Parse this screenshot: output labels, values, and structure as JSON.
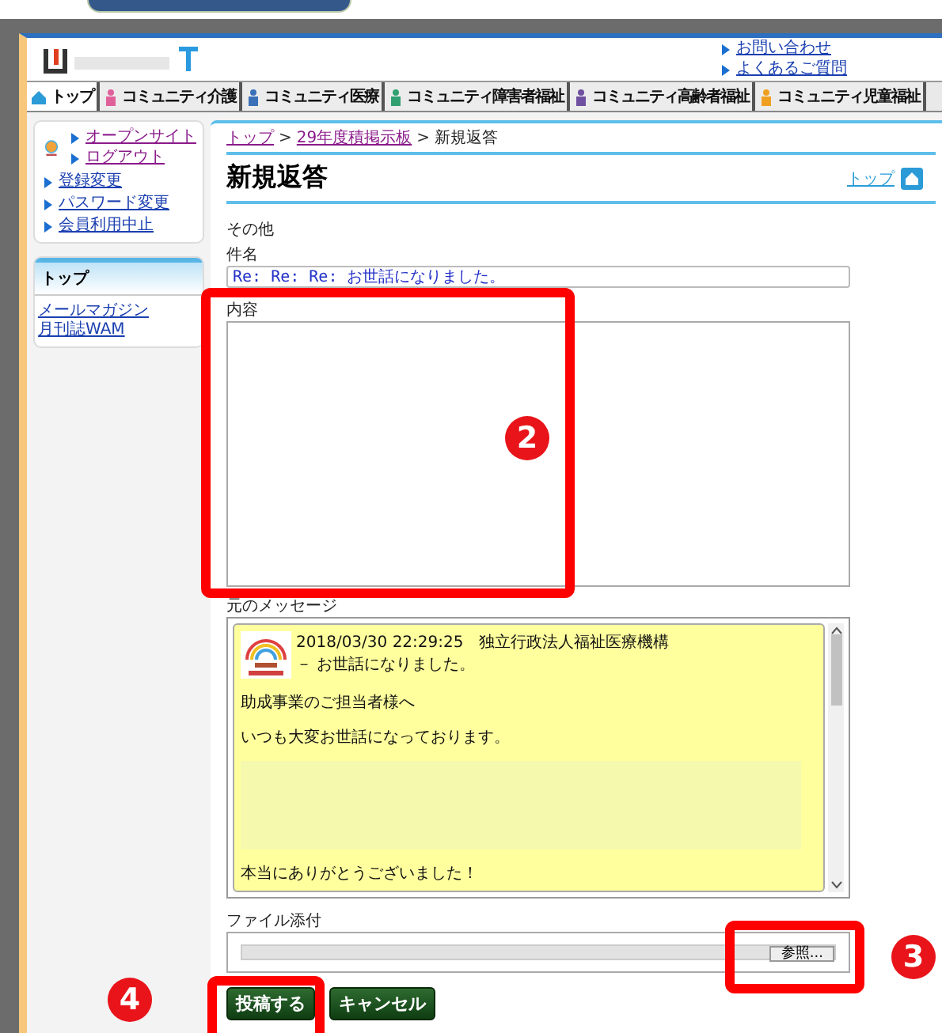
{
  "header": {
    "links": [
      "お問い合わせ",
      "よくあるご質問"
    ]
  },
  "nav_tabs": [
    {
      "label": "トップ",
      "kind": "home",
      "selected": true
    },
    {
      "label": "コミュニティ介護",
      "kind": "care",
      "selected": false
    },
    {
      "label": "コミュニティ医療",
      "kind": "medical",
      "selected": false
    },
    {
      "label": "コミュニティ障害者福祉",
      "kind": "disability",
      "selected": false
    },
    {
      "label": "コミュニティ高齢者福祉",
      "kind": "elderly",
      "selected": false
    },
    {
      "label": "コミュニティ児童福祉",
      "kind": "child",
      "selected": false
    }
  ],
  "sidebar": {
    "user_links": [
      "オープンサイト",
      "ログアウト",
      "登録変更",
      "パスワード変更",
      "会員利用中止"
    ],
    "section": {
      "title": "トップ",
      "links": [
        "メールマガジン",
        "月刊誌WAM"
      ]
    }
  },
  "breadcrumbs": [
    {
      "label": "トップ",
      "link": true
    },
    {
      "label": "29年度積掲示板",
      "link": true
    },
    {
      "label": "新規返答",
      "link": false
    }
  ],
  "breadcrumb_separator": ">",
  "page_title": "新規返答",
  "top_link": "トップ",
  "form": {
    "category": "その他",
    "subject_label": "件名",
    "subject_value": "Re: Re: Re: お世話になりました。",
    "content_label": "内容",
    "original_label": "元のメッセージ",
    "original_message": {
      "meta": "2018/03/30 22:29:25　独立行政法人福祉医療機構",
      "subject": "－ お世話になりました。",
      "lines": [
        "助成事業のご担当者様へ",
        "いつも大変お世話になっております。"
      ],
      "closing": "本当にありがとうございました！"
    },
    "attach_label": "ファイル添付",
    "browse_button": "参照...",
    "buttons": [
      "投稿する",
      "キャンセル"
    ]
  },
  "annotations": [
    {
      "label": "2"
    },
    {
      "label": "3"
    },
    {
      "label": "4"
    }
  ]
}
